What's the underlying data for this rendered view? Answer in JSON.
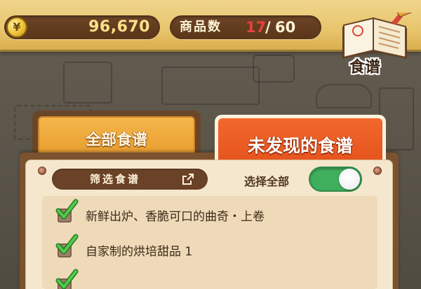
{
  "hud": {
    "currency_symbol": "¥",
    "money": "96,670",
    "goods_label": "商品数",
    "goods_current": "17",
    "goods_separator": "/",
    "goods_total": "60"
  },
  "recipe_book": {
    "label": "食谱",
    "icon": "recipe-book-icon"
  },
  "tabs": [
    {
      "label": "全部食谱",
      "selected": false
    },
    {
      "label": "未发现的食谱",
      "selected": true
    }
  ],
  "filter": {
    "label": "筛选食谱",
    "icon": "external-link-icon"
  },
  "select_all": {
    "label": "选择全部",
    "on": true
  },
  "recipes": [
    {
      "label": "新鲜出炉、香脆可口的曲奇・上卷",
      "checked": true
    },
    {
      "label": "自家制的烘培甜品 1",
      "checked": true
    },
    {
      "label": "",
      "checked": true
    }
  ],
  "colors": {
    "toggle_on": "#3fae5d",
    "selected_tab": "#e4511c",
    "goods_current": "#e5423a",
    "check": "#3cae3c"
  }
}
